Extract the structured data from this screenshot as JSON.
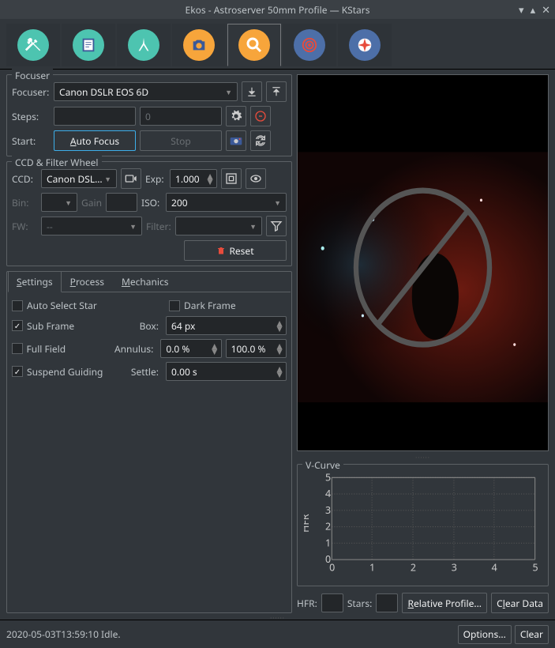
{
  "window": {
    "title": "Ekos - Astroserver 50mm Profile — KStars"
  },
  "tabs": [
    "setup",
    "scheduler",
    "mount",
    "capture",
    "focus",
    "align",
    "guide"
  ],
  "active_tab": 4,
  "focuser": {
    "title": "Focuser",
    "focuser_label": "Focuser:",
    "focuser_value": "Canon DSLR EOS 6D",
    "steps_label": "Steps:",
    "steps_value": "",
    "steps_placeholder": "0",
    "start_label": "Start:",
    "autofocus_label": "Auto Focus",
    "stop_label": "Stop"
  },
  "ccd": {
    "title": "CCD & Filter Wheel",
    "ccd_label": "CCD:",
    "ccd_value": "Canon DSLR E",
    "exp_label": "Exp:",
    "exp_value": "1.000",
    "bin_label": "Bin:",
    "bin_value": "",
    "gain_label": "Gain",
    "gain_value": "",
    "iso_label": "ISO:",
    "iso_value": "200",
    "fw_label": "FW:",
    "fw_value": "--",
    "filter_label": "Filter:",
    "filter_value": "",
    "reset_label": "Reset"
  },
  "settings": {
    "tabs": [
      "Settings",
      "Process",
      "Mechanics"
    ],
    "active": 0,
    "auto_select_star": {
      "label": "Auto Select Star",
      "checked": false
    },
    "dark_frame": {
      "label": "Dark Frame",
      "checked": false
    },
    "sub_frame": {
      "label": "Sub Frame",
      "checked": true
    },
    "box_label": "Box:",
    "box_value": "64 px",
    "full_field": {
      "label": "Full Field",
      "checked": false
    },
    "annulus_label": "Annulus:",
    "annulus_low": "0.0 %",
    "annulus_high": "100.0 %",
    "suspend_guiding": {
      "label": "Suspend Guiding",
      "checked": true
    },
    "settle_label": "Settle:",
    "settle_value": "0.00 s"
  },
  "vcurve": {
    "title": "V-Curve",
    "ylabel": "HFR",
    "hfr_label": "HFR:",
    "hfr_value": "",
    "stars_label": "Stars:",
    "stars_value": "",
    "rel_profile": "Relative Profile...",
    "clear_data": "Clear Data"
  },
  "chart_data": {
    "type": "line",
    "x": [
      0,
      1,
      2,
      3,
      4,
      5
    ],
    "series": [
      {
        "name": "HFR",
        "values": []
      }
    ],
    "xlabel": "",
    "ylabel": "HFR",
    "xlim": [
      0,
      5
    ],
    "ylim": [
      0,
      5
    ],
    "xticks": [
      0,
      1,
      2,
      3,
      4,
      5
    ],
    "yticks": [
      0,
      1,
      2,
      3,
      4,
      5
    ],
    "grid": true
  },
  "status": {
    "text": "2020-05-03T13:59:10 Idle.",
    "options": "Options...",
    "clear": "Clear"
  }
}
